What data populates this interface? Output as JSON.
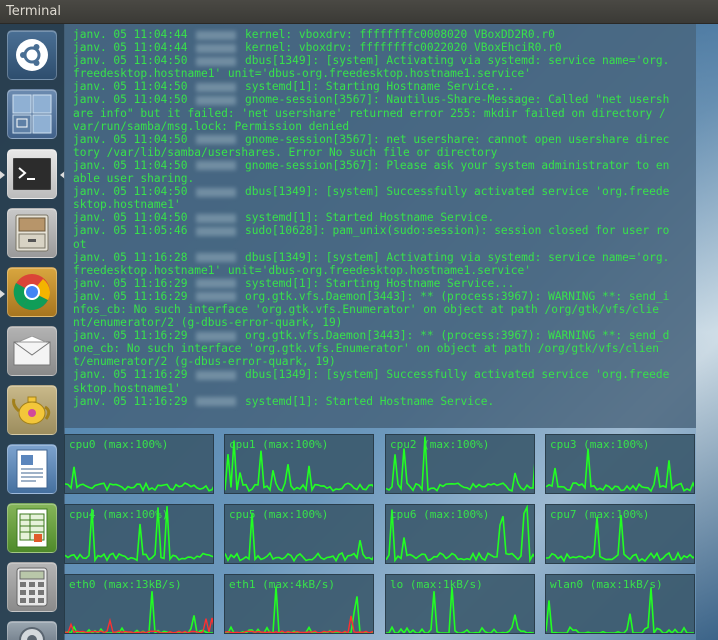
{
  "window": {
    "title": "Terminal"
  },
  "launcher": {
    "items": [
      {
        "name": "ubuntu-dash-button",
        "icon": "ubuntu-logo-icon"
      },
      {
        "name": "workspace-switcher-button",
        "icon": "workspaces-icon"
      },
      {
        "name": "terminal-launcher-button",
        "icon": "terminal-icon"
      },
      {
        "name": "file-manager-launcher-button",
        "icon": "file-cabinet-icon"
      },
      {
        "name": "chrome-launcher-button",
        "icon": "chrome-icon"
      },
      {
        "name": "mail-launcher-button",
        "icon": "envelope-icon"
      },
      {
        "name": "teapot-launcher-button",
        "icon": "teapot-icon"
      },
      {
        "name": "writer-launcher-button",
        "icon": "document-icon"
      },
      {
        "name": "calc-launcher-button",
        "icon": "spreadsheet-icon"
      },
      {
        "name": "calculator-launcher-button",
        "icon": "calculator-icon"
      },
      {
        "name": "settings-launcher-button",
        "icon": "settings-icon"
      }
    ]
  },
  "terminal": {
    "lines": [
      "janv. 05 11:04:44 ~~ kernel: vboxdrv: ffffffffc0008020 VBoxDD2R0.r0",
      "janv. 05 11:04:44 ~~ kernel: vboxdrv: ffffffffc0022020 VBoxEhciR0.r0",
      "janv. 05 11:04:50 ~~ dbus[1349]: [system] Activating via systemd: service name='org.",
      "freedesktop.hostname1' unit='dbus-org.freedesktop.hostname1.service'",
      "janv. 05 11:04:50 ~~ systemd[1]: Starting Hostname Service...",
      "janv. 05 11:04:50 ~~ gnome-session[3567]: Nautilus-Share-Message: Called \"net usersh",
      "are info\" but it failed: 'net usershare' returned error 255: mkdir failed on directory /",
      "var/run/samba/msg.lock: Permission denied",
      "janv. 05 11:04:50 ~~ gnome-session[3567]: net usershare: cannot open usershare direc",
      "tory /var/lib/samba/usershares. Error No such file or directory",
      "janv. 05 11:04:50 ~~ gnome-session[3567]: Please ask your system administrator to en",
      "able user sharing.",
      "janv. 05 11:04:50 ~~ dbus[1349]: [system] Successfully activated service 'org.freede",
      "sktop.hostname1'",
      "janv. 05 11:04:50 ~~ systemd[1]: Started Hostname Service.",
      "janv. 05 11:05:46 ~~ sudo[10628]: pam_unix(sudo:session): session closed for user ro",
      "ot",
      "janv. 05 11:16:28 ~~ dbus[1349]: [system] Activating via systemd: service name='org.",
      "freedesktop.hostname1' unit='dbus-org.freedesktop.hostname1.service'",
      "janv. 05 11:16:29 ~~ systemd[1]: Starting Hostname Service...",
      "janv. 05 11:16:29 ~~ org.gtk.vfs.Daemon[3443]: ** (process:3967): WARNING **: send_i",
      "nfos_cb: No such interface 'org.gtk.vfs.Enumerator' on object at path /org/gtk/vfs/clie",
      "nt/enumerator/2 (g-dbus-error-quark, 19)",
      "janv. 05 11:16:29 ~~ org.gtk.vfs.Daemon[3443]: ** (process:3967): WARNING **: send_d",
      "one_cb: No such interface 'org.gtk.vfs.Enumerator' on object at path /org/gtk/vfs/clien",
      "t/enumerator/2 (g-dbus-error-quark, 19)",
      "janv. 05 11:16:29 ~~ dbus[1349]: [system] Successfully activated service 'org.freede",
      "sktop.hostname1'",
      "janv. 05 11:16:29 ~~ systemd[1]: Started Hostname Service."
    ]
  },
  "monitors": [
    {
      "label": "cpu0 (max:100%)"
    },
    {
      "label": "cpu1 (max:100%)"
    },
    {
      "label": "cpu2 (max:100%)"
    },
    {
      "label": "cpu3 (max:100%)"
    },
    {
      "label": "cpu4 (max:100%)"
    },
    {
      "label": "cpu5 (max:100%)"
    },
    {
      "label": "cpu6 (max:100%)"
    },
    {
      "label": "cpu7 (max:100%)"
    },
    {
      "label": "eth0 (max:13kB/s)"
    },
    {
      "label": "eth1 (max:4kB/s)"
    },
    {
      "label": "lo (max:1kB/s)"
    },
    {
      "label": "wlan0 (max:1kB/s)"
    }
  ],
  "colors": {
    "terminal_text": "#38e24a",
    "graph_line": "#22ff22",
    "graph_alt": "#ff3030"
  }
}
